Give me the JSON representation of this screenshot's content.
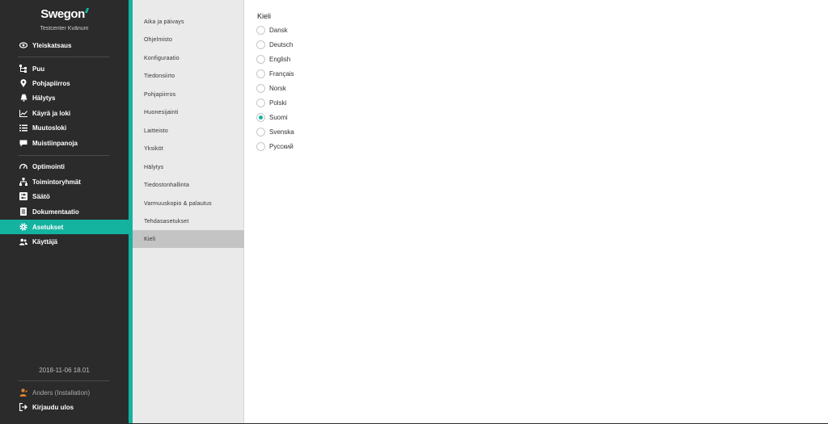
{
  "brand": {
    "logo_text": "Swegon",
    "site_name": "Testcenter Kvänum",
    "accent_color": "#14b3a0"
  },
  "sidebar": {
    "items": [
      {
        "label": "Yleiskatsaus",
        "icon": "eye-icon"
      },
      {
        "label": "Puu",
        "icon": "tree-icon"
      },
      {
        "label": "Pohjapiirros",
        "icon": "map-pin-icon"
      },
      {
        "label": "Hälytys",
        "icon": "bell-icon"
      },
      {
        "label": "Käyrä ja loki",
        "icon": "chart-line-icon"
      },
      {
        "label": "Muutosloki",
        "icon": "list-icon"
      },
      {
        "label": "Muistiinpanoja",
        "icon": "comment-icon"
      },
      {
        "label": "Optimointi",
        "icon": "gauge-icon"
      },
      {
        "label": "Toimintoryhmät",
        "icon": "sitemap-icon"
      },
      {
        "label": "Säätö",
        "icon": "sliders-icon"
      },
      {
        "label": "Dokumentaatio",
        "icon": "document-icon"
      },
      {
        "label": "Asetukset",
        "icon": "gear-icon",
        "active": true
      },
      {
        "label": "Käyttäjä",
        "icon": "users-icon"
      }
    ],
    "datetime": "2018-11-06 18.01",
    "user_label": "Anders (Installation)",
    "logout_label": "Kirjaudu ulos"
  },
  "submenu": {
    "items": [
      "Aika ja päivays",
      "Ohjelmisto",
      "Konfiguraatio",
      "Tiedonsiirto",
      "Pohjapiirros",
      "Huonesijainti",
      "Laitteisto",
      "Yksiköt",
      "Hälytys",
      "Tiedostonhallinta",
      "Varmuuskopio & palautus",
      "Tehdasasetukset",
      "Kieli"
    ],
    "active": "Kieli"
  },
  "main": {
    "title": "Kieli",
    "options": [
      "Dansk",
      "Deutsch",
      "English",
      "Français",
      "Norsk",
      "Polski",
      "Suomi",
      "Svenska",
      "Русский"
    ],
    "selected": "Suomi"
  }
}
